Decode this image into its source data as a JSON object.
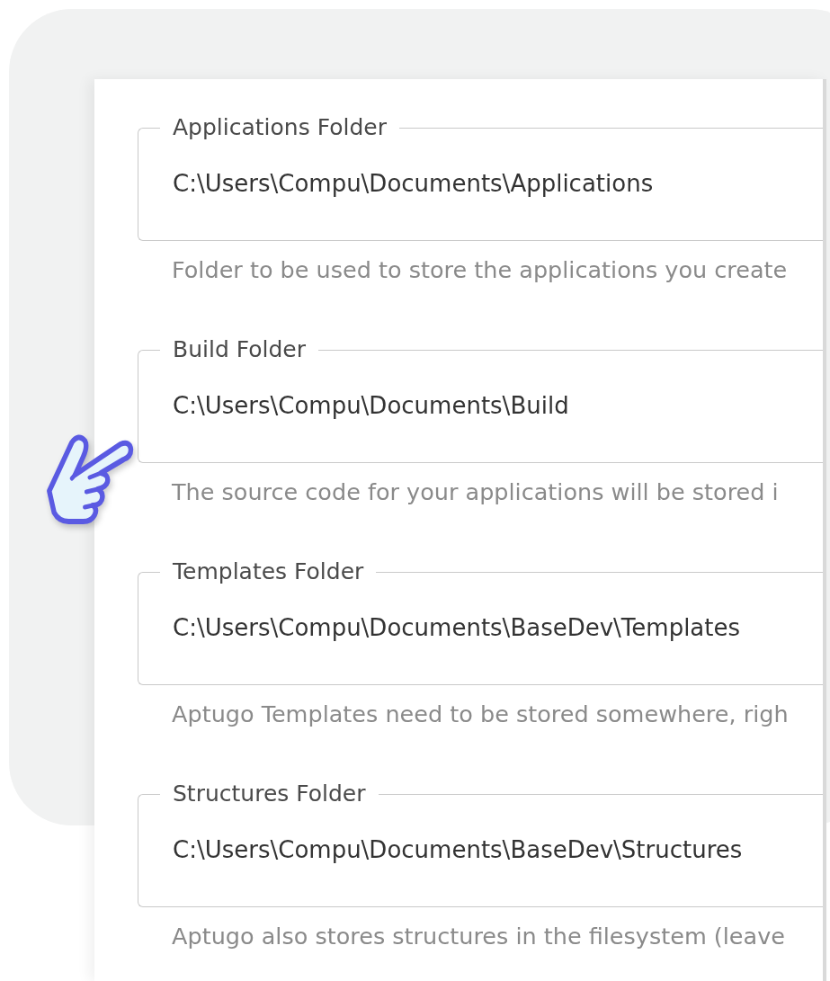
{
  "folders": [
    {
      "label": "Applications Folder",
      "value": "C:\\Users\\Compu\\Documents\\Applications",
      "help": "Folder to be used to store the applications you create"
    },
    {
      "label": "Build Folder",
      "value": "C:\\Users\\Compu\\Documents\\Build",
      "help": "The source code for your applications will be stored i"
    },
    {
      "label": "Templates Folder",
      "value": "C:\\Users\\Compu\\Documents\\BaseDev\\Templates",
      "help": "Aptugo Templates need to be stored somewhere, righ"
    },
    {
      "label": "Structures Folder",
      "value": "C:\\Users\\Compu\\Documents\\BaseDev\\Structures",
      "help": "Aptugo also stores structures in the filesystem (leave"
    }
  ]
}
